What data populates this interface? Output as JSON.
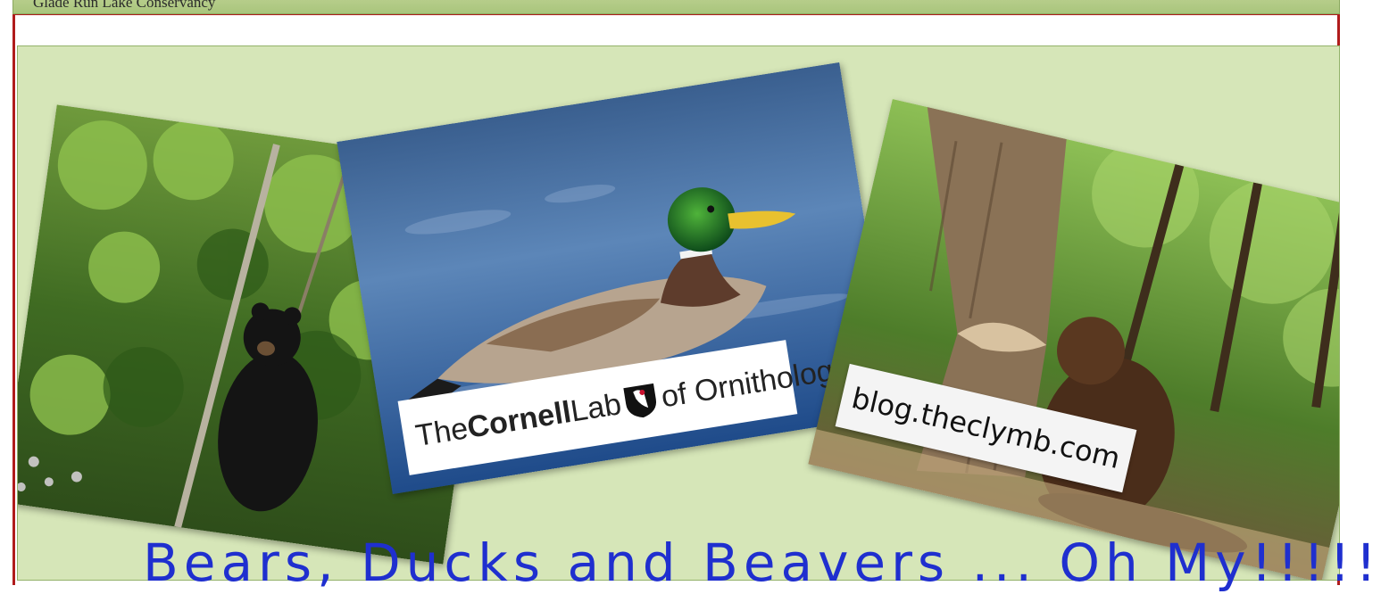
{
  "slide": {
    "title": "Glade Run Lake Conservancy",
    "caption": "Bears, Ducks and Beavers ... Oh My!!!!!"
  },
  "photos": {
    "bear": {
      "alt": "black bear in forest"
    },
    "duck": {
      "alt": "mallard duck swimming",
      "credit_prefix": "The",
      "credit_bold": "Cornell",
      "credit_lab": "Lab",
      "credit_suffix": "of Ornithology"
    },
    "beaver": {
      "alt": "beaver chewing tree",
      "credit": "blog.theclymb.com"
    }
  },
  "colors": {
    "panel": "#d6e6b8",
    "frame": "#b01c1c",
    "caption": "#1f2fcf"
  }
}
